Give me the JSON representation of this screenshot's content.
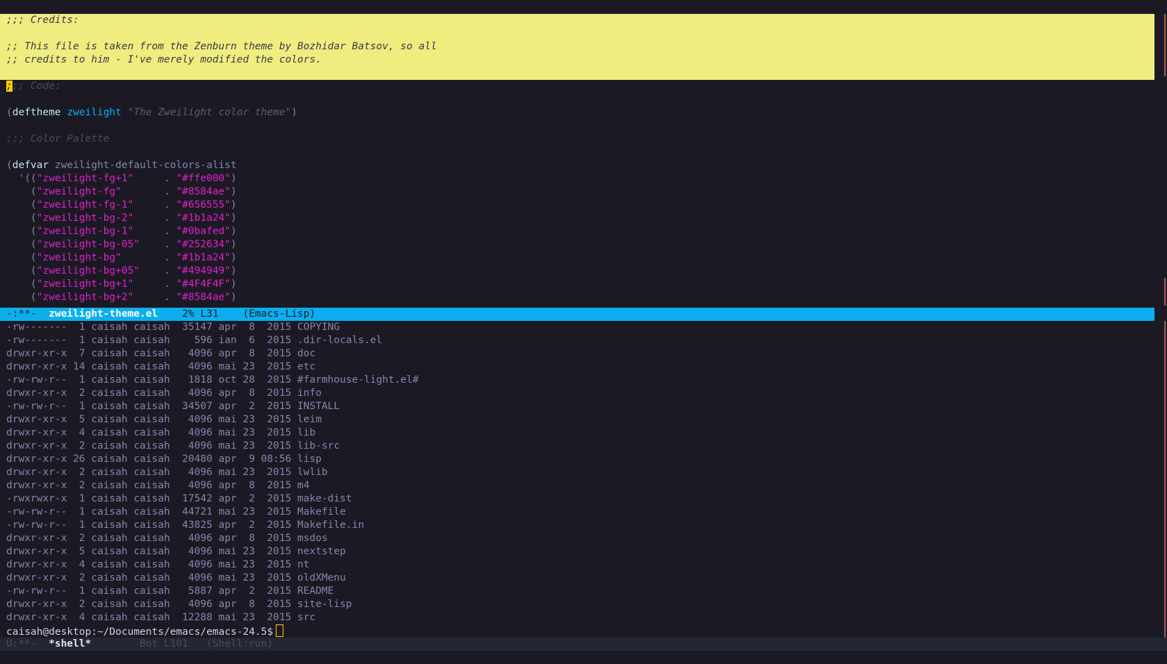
{
  "colors": {
    "background": "#1b1a24",
    "highlight": "#efed80",
    "modeline_active": "#0bafed",
    "modeline_inactive": "#252634",
    "string": "#e020c8",
    "keyword": "#bfe3f5",
    "function_name": "#0bafed",
    "cursor": "#ffce00"
  },
  "editor": {
    "credits_header": ";;; Credits:",
    "credits_line1": ";; This file is taken from the Zenburn theme by Bozhidar Batsov, so all",
    "credits_line2": ";; credits to him - I've merely modified the colors.",
    "code_cursor_char": ";",
    "code_comment_rest": ";; Code:",
    "deftheme_kw": "deftheme",
    "theme_name": "zweilight",
    "theme_doc": "\"The Zweilight color theme\"",
    "palette_comment": ";;; Color Palette",
    "defvar_kw": "defvar",
    "defvar_name": "zweilight-default-colors-alist",
    "colors": [
      {
        "prefix": "  '((",
        "name": "\"zweilight-fg+1\"",
        "pad": "     . ",
        "value": "\"#ffe000\""
      },
      {
        "prefix": "    (",
        "name": "\"zweilight-fg\"",
        "pad": "       . ",
        "value": "\"#8584ae\""
      },
      {
        "prefix": "    (",
        "name": "\"zweilight-fg-1\"",
        "pad": "     . ",
        "value": "\"#656555\""
      },
      {
        "prefix": "    (",
        "name": "\"zweilight-bg-2\"",
        "pad": "     . ",
        "value": "\"#1b1a24\""
      },
      {
        "prefix": "    (",
        "name": "\"zweilight-bg-1\"",
        "pad": "     . ",
        "value": "\"#0bafed\""
      },
      {
        "prefix": "    (",
        "name": "\"zweilight-bg-05\"",
        "pad": "    . ",
        "value": "\"#252634\""
      },
      {
        "prefix": "    (",
        "name": "\"zweilight-bg\"",
        "pad": "       . ",
        "value": "\"#1b1a24\""
      },
      {
        "prefix": "    (",
        "name": "\"zweilight-bg+05\"",
        "pad": "    . ",
        "value": "\"#494949\""
      },
      {
        "prefix": "    (",
        "name": "\"zweilight-bg+1\"",
        "pad": "     . ",
        "value": "\"#4F4F4F\""
      },
      {
        "prefix": "    (",
        "name": "\"zweilight-bg+2\"",
        "pad": "     . ",
        "value": "\"#8584ae\""
      }
    ]
  },
  "modeline_top": {
    "status": "-:**-  ",
    "buffer": "zweilight-theme.el",
    "position": "    2% L31    ",
    "mode": "(Emacs-Lisp)"
  },
  "shell": {
    "listing": [
      "-rw-------  1 caisah caisah  35147 apr  8  2015 COPYING",
      "-rw-------  1 caisah caisah    596 ian  6  2015 .dir-locals.el",
      "drwxr-xr-x  7 caisah caisah   4096 apr  8  2015 doc",
      "drwxr-xr-x 14 caisah caisah   4096 mai 23  2015 etc",
      "-rw-rw-r--  1 caisah caisah   1818 oct 28  2015 #farmhouse-light.el#",
      "drwxr-xr-x  2 caisah caisah   4096 apr  8  2015 info",
      "-rw-rw-r--  1 caisah caisah  34507 apr  2  2015 INSTALL",
      "drwxr-xr-x  5 caisah caisah   4096 mai 23  2015 leim",
      "drwxr-xr-x  4 caisah caisah   4096 mai 23  2015 lib",
      "drwxr-xr-x  2 caisah caisah   4096 mai 23  2015 lib-src",
      "drwxr-xr-x 26 caisah caisah  20480 apr  9 08:56 lisp",
      "drwxr-xr-x  2 caisah caisah   4096 mai 23  2015 lwlib",
      "drwxr-xr-x  2 caisah caisah   4096 apr  8  2015 m4",
      "-rwxrwxr-x  1 caisah caisah  17542 apr  2  2015 make-dist",
      "-rw-rw-r--  1 caisah caisah  44721 mai 23  2015 Makefile",
      "-rw-rw-r--  1 caisah caisah  43825 apr  2  2015 Makefile.in",
      "drwxr-xr-x  2 caisah caisah   4096 apr  8  2015 msdos",
      "drwxr-xr-x  5 caisah caisah   4096 mai 23  2015 nextstep",
      "drwxr-xr-x  4 caisah caisah   4096 mai 23  2015 nt",
      "drwxr-xr-x  2 caisah caisah   4096 mai 23  2015 oldXMenu",
      "-rw-rw-r--  1 caisah caisah   5887 apr  2  2015 README",
      "drwxr-xr-x  2 caisah caisah   4096 apr  8  2015 site-lisp",
      "drwxr-xr-x  4 caisah caisah  12288 mai 23  2015 src"
    ],
    "prompt": "caisah@desktop:~/Documents/emacs/emacs-24.5$"
  },
  "modeline_bottom": {
    "status": "U:**-  ",
    "buffer": "*shell*",
    "position": "        Bot L101   ",
    "mode": "(Shell:run)"
  }
}
